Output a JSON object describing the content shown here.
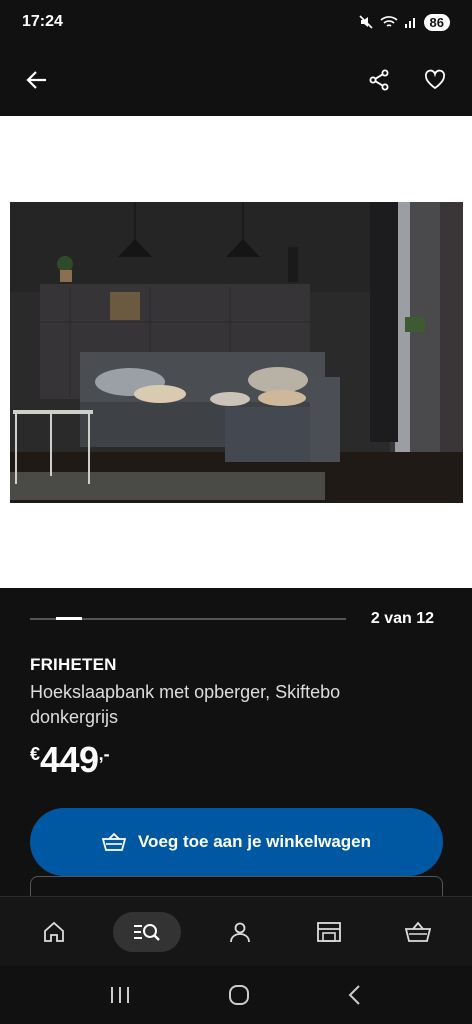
{
  "status_bar": {
    "time": "17:24",
    "battery": "86"
  },
  "app_bar": {
    "back_icon": "arrow-left-icon",
    "share_icon": "share-icon",
    "favorite_icon": "heart-icon"
  },
  "gallery": {
    "counter": "2 van 12",
    "current_index": 2,
    "total": 12
  },
  "product": {
    "name": "FRIHETEN",
    "description": "Hoekslaapbank met opberger, Skiftebo donkergrijs",
    "price_currency": "€",
    "price_amount": "449",
    "price_decimals": ",-"
  },
  "add_to_cart": {
    "label": "Voeg toe aan je winkelwagen",
    "icon": "basket-icon"
  },
  "tab_bar": {
    "items": [
      {
        "name": "home",
        "icon": "home-icon",
        "active": false
      },
      {
        "name": "search",
        "icon": "search-icon",
        "active": true
      },
      {
        "name": "account",
        "icon": "person-icon",
        "active": false
      },
      {
        "name": "store",
        "icon": "store-icon",
        "active": false
      },
      {
        "name": "cart",
        "icon": "basket-icon",
        "active": false
      }
    ]
  },
  "colors": {
    "accent": "#0058a3",
    "background": "#111111",
    "surface": "#ffffff"
  }
}
